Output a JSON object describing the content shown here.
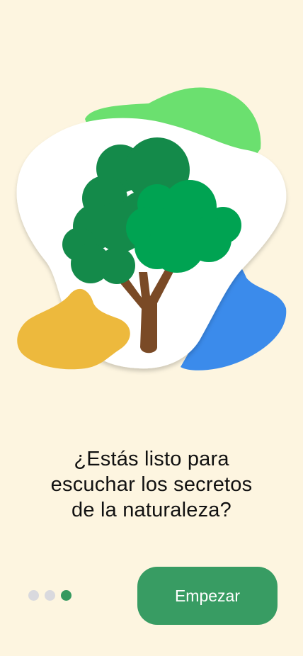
{
  "onboarding": {
    "headline_lines": [
      "¿Estás listo para",
      "escuchar los secretos",
      "de la naturaleza?"
    ],
    "pagination": {
      "total": 3,
      "current": 3
    },
    "start_button_label": "Empezar",
    "illustration_icon": "tree-icon"
  },
  "colors": {
    "background": "#FDF5E0",
    "accent_green": "#389C63",
    "tree_dark": "#148A4A",
    "tree_light": "#00A352",
    "trunk": "#7A4A26",
    "blob_green": "#6BE06F",
    "blob_blue": "#3B8BEB",
    "blob_yellow": "#EDB93D",
    "dot_inactive": "#D9D9DE"
  }
}
